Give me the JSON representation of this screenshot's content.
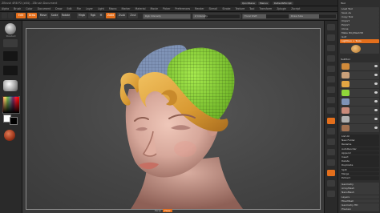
{
  "app": {
    "title_fragment": "ZBrush",
    "window_title": "ZBrush 4R8 P2 (x64) - ZBrush Document",
    "title_chips": [
      "QuickSave",
      "Menus",
      "DefaultZScript"
    ]
  },
  "menu_bar": {
    "items": [
      "Alpha",
      "Brush",
      "Color",
      "Document",
      "Draw",
      "Edit",
      "File",
      "Layer",
      "Light",
      "Macro",
      "Marker",
      "Material",
      "Movie",
      "Picker",
      "Preferences",
      "Render",
      "Stencil",
      "Stroke",
      "Texture",
      "Tool",
      "Transform",
      "Zplugin",
      "Zscript"
    ]
  },
  "top_shelf": {
    "buttons": [
      {
        "label": "Edit",
        "state": "on"
      },
      {
        "label": "Draw",
        "state": "on"
      },
      {
        "label": "Move",
        "state": "off"
      },
      {
        "label": "Scale",
        "state": "off"
      },
      {
        "label": "Rotate",
        "state": "off"
      }
    ],
    "toggles": [
      {
        "label": "Mrgb",
        "state": "off"
      },
      {
        "label": "Rgb",
        "state": "off"
      },
      {
        "label": "M",
        "state": "off"
      },
      {
        "label": "Zadd",
        "state": "on"
      },
      {
        "label": "Zsub",
        "state": "off"
      },
      {
        "label": "Zcut",
        "state": "off"
      }
    ],
    "sliders": [
      {
        "label": "Rgb Intensity",
        "value_fraction": 1.0
      },
      {
        "label": "Z Intensity",
        "value_fraction": 0.25
      },
      {
        "label": "Focal Shift",
        "value_fraction": 0.5
      },
      {
        "label": "Draw Size",
        "value_fraction": 0.64
      }
    ]
  },
  "left_shelf": {
    "tiles": [
      {
        "name": "brush-icon",
        "label": "Standard"
      },
      {
        "name": "stroke-icon",
        "label": ""
      },
      {
        "name": "alpha-icon",
        "label": ""
      },
      {
        "name": "texture-icon",
        "label": ""
      },
      {
        "name": "material-icon",
        "label": ""
      }
    ],
    "colors": {
      "fg": "#ffffff",
      "bg": "#000000",
      "material": "#a23a1e"
    }
  },
  "canvas": {
    "status_text": "Persp",
    "status_chip": "Floor",
    "colors": {
      "hair_yellow": "#e2a643",
      "skin": "#d7a89b",
      "polygroup_green": "#8fd63a",
      "polygroup_blue": "#7f93b6",
      "accent": "#e46f1c"
    }
  },
  "right_shelf": {
    "buttons": [
      "bpr-icon",
      "spix-icon",
      "scroll-icon",
      "zoom-icon",
      "actual-icon",
      "aahalf-icon",
      "persp-icon",
      "floor-icon",
      "local-icon",
      "xyz-icon",
      "frame-icon",
      "move-icon",
      "scale-icon",
      "rotate-icon",
      "polyf-icon",
      "transp-icon",
      "solo-icon"
    ],
    "active": [
      "xyz-icon",
      "polyf-icon"
    ]
  },
  "tool_palette": {
    "header": "Tool",
    "rows": [
      {
        "label": "Load Tool",
        "style": "normal"
      },
      {
        "label": "Save As",
        "style": "normal"
      },
      {
        "label": "Copy Tool",
        "style": "normal"
      },
      {
        "label": "Import",
        "style": "normal"
      },
      {
        "label": "Export",
        "style": "normal"
      },
      {
        "label": "Clone",
        "style": "normal"
      },
      {
        "label": "Make PolyMesh3D",
        "style": "normal"
      },
      {
        "label": "GoZ",
        "style": "normal"
      },
      {
        "label": "Lightbox > Tools",
        "style": "orange"
      }
    ],
    "section": "SubTool",
    "subtools": 8,
    "lower_rows": [
      "List All",
      "New Folder",
      "Rename",
      "AutoReorder",
      "Append",
      "Insert",
      "Delete",
      "Duplicate",
      "Split",
      "Merge",
      "Extract"
    ],
    "bottom_rows": [
      "Geometry",
      "ArrayMesh",
      "NanoMesh",
      "Layers",
      "FiberMesh",
      "Geometry HD",
      "Preview"
    ]
  }
}
